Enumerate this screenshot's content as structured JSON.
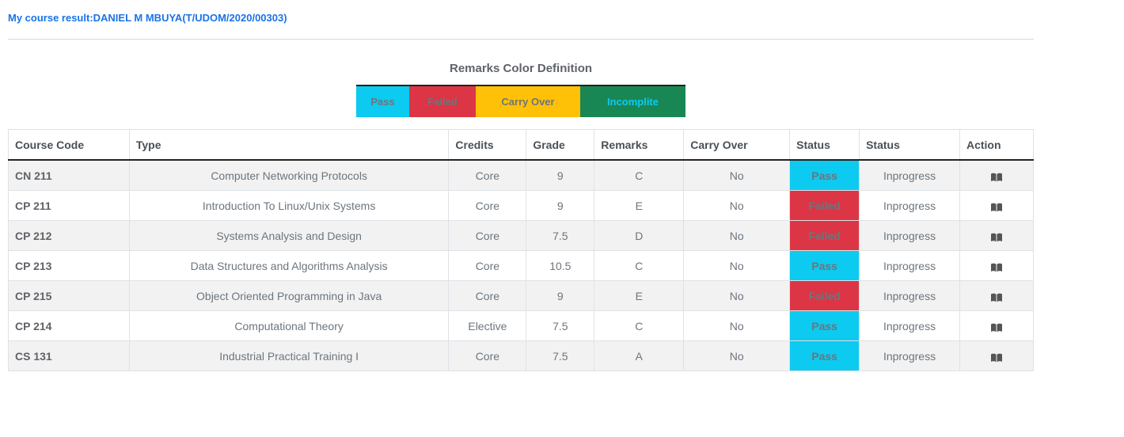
{
  "header": {
    "title": "My course result:DANIEL M MBUYA(T/UDOM/2020/00303)"
  },
  "legend": {
    "title": "Remarks Color Definition",
    "items": [
      {
        "label": "Pass",
        "color": "#0dcaf0"
      },
      {
        "label": "Failed",
        "color": "#dc3545"
      },
      {
        "label": "Carry Over",
        "color": "#ffc107"
      },
      {
        "label": "Incomplite",
        "color": "#198754"
      }
    ]
  },
  "table": {
    "columns": [
      "Course Code",
      "Type",
      "Credits",
      "Grade",
      "Remarks",
      "Carry Over",
      "Status",
      "Status",
      "Action"
    ],
    "rows": [
      {
        "code": "CN 211",
        "type": "Computer Networking Protocols",
        "credits": "Core",
        "grade": "9",
        "remarks": "C",
        "carry_over": "No",
        "status": "Pass",
        "progress": "Inprogress",
        "action_icon": "book-icon"
      },
      {
        "code": "CP 211",
        "type": "Introduction To Linux/Unix Systems",
        "credits": "Core",
        "grade": "9",
        "remarks": "E",
        "carry_over": "No",
        "status": "Failed",
        "progress": "Inprogress",
        "action_icon": "book-icon"
      },
      {
        "code": "CP 212",
        "type": "Systems Analysis and Design",
        "credits": "Core",
        "grade": "7.5",
        "remarks": "D",
        "carry_over": "No",
        "status": "Failed",
        "progress": "Inprogress",
        "action_icon": "book-icon"
      },
      {
        "code": "CP 213",
        "type": "Data Structures and Algorithms Analysis",
        "credits": "Core",
        "grade": "10.5",
        "remarks": "C",
        "carry_over": "No",
        "status": "Pass",
        "progress": "Inprogress",
        "action_icon": "book-icon"
      },
      {
        "code": "CP 215",
        "type": "Object Oriented Programming in Java",
        "credits": "Core",
        "grade": "9",
        "remarks": "E",
        "carry_over": "No",
        "status": "Failed",
        "progress": "Inprogress",
        "action_icon": "book-icon"
      },
      {
        "code": "CP 214",
        "type": "Computational Theory",
        "credits": "Elective",
        "grade": "7.5",
        "remarks": "C",
        "carry_over": "No",
        "status": "Pass",
        "progress": "Inprogress",
        "action_icon": "book-icon"
      },
      {
        "code": "CS 131",
        "type": "Industrial Practical Training I",
        "credits": "Core",
        "grade": "7.5",
        "remarks": "A",
        "carry_over": "No",
        "status": "Pass",
        "progress": "Inprogress",
        "action_icon": "book-icon"
      }
    ]
  }
}
